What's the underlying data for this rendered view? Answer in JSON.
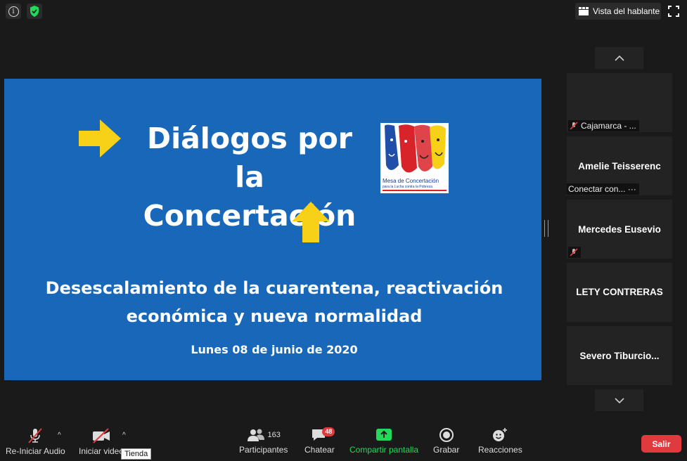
{
  "top_bar": {
    "view_button_label": "Vista del hablante"
  },
  "slide": {
    "title_line1": "Diálogos por la",
    "title_line2": "Concertación",
    "subtitle_line1": "Desescalamiento de la cuarentena, reactivación",
    "subtitle_line2": "económica y nueva normalidad",
    "date": "Lunes 08 de junio de 2020",
    "logo_text": "Mesa de Concertación",
    "logo_subtext": "para la Lucha contra la Pobreza"
  },
  "participants_panel": {
    "tiles": [
      {
        "name": "",
        "tag": "Cajamarca - ...",
        "muted": true
      },
      {
        "name": "Amelie Teisserenc",
        "tag": "Conectar con... ···",
        "muted": false
      },
      {
        "name": "Mercedes Eusevio",
        "tag": "",
        "muted": true
      },
      {
        "name": "LETY CONTRERAS",
        "tag": "",
        "muted": false
      },
      {
        "name": "Severo  Tiburcio...",
        "tag": "",
        "muted": false
      }
    ]
  },
  "toolbar": {
    "audio_label": "Re-Iniciar Audio",
    "video_label": "Iniciar video",
    "tooltip": "Tienda",
    "participants_label": "Participantes",
    "participants_count": "163",
    "chat_label": "Chatear",
    "chat_badge": "48",
    "share_label": "Compartir pantalla",
    "record_label": "Grabar",
    "reactions_label": "Reacciones",
    "leave_label": "Salir"
  },
  "colors": {
    "slide_bg": "#1867b9",
    "arrow_yellow": "#f7d117",
    "share_green": "#23d959",
    "leave_red": "#e0393e"
  }
}
